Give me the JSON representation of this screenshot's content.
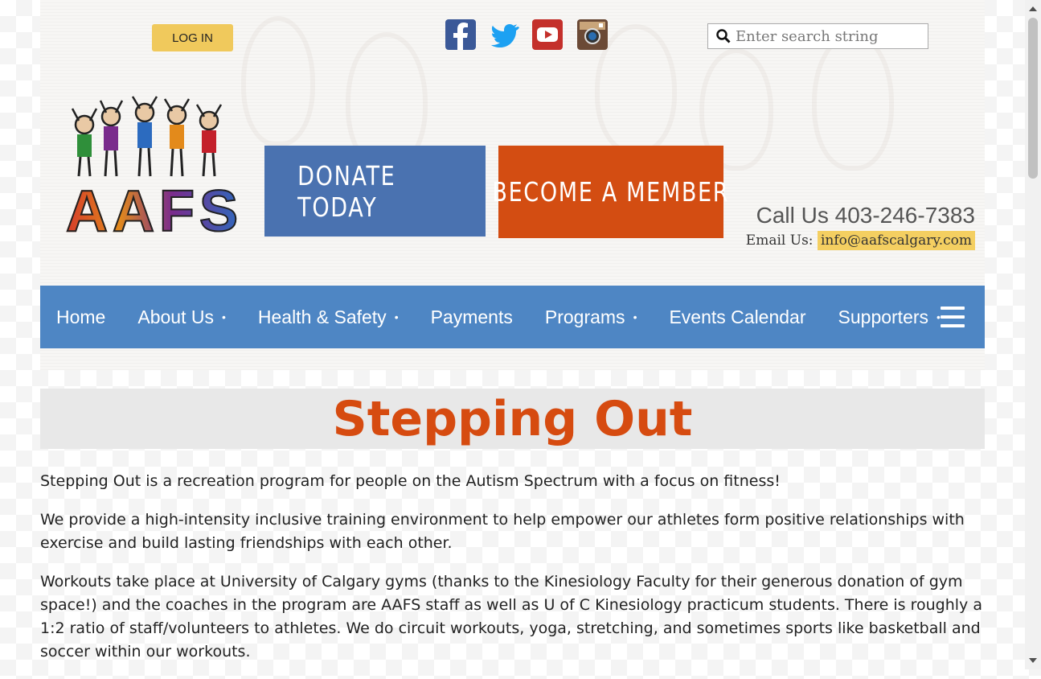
{
  "header": {
    "login_label": "LOG IN",
    "search_placeholder": "Enter search string",
    "social": [
      {
        "name": "facebook",
        "icon": "facebook-icon"
      },
      {
        "name": "twitter",
        "icon": "twitter-icon"
      },
      {
        "name": "youtube",
        "icon": "youtube-icon"
      },
      {
        "name": "instagram",
        "icon": "instagram-icon"
      }
    ],
    "logo_text": "AAFS",
    "donate_label": "DONATE TODAY",
    "member_label": "BECOME A MEMBER",
    "call_us": "Call Us 403-246-7383",
    "email_label": "Email Us:",
    "email": "info@aafscalgary.com"
  },
  "nav": {
    "items": [
      {
        "label": "Home",
        "has_sub": false
      },
      {
        "label": "About Us",
        "has_sub": true
      },
      {
        "label": "Health & Safety",
        "has_sub": true
      },
      {
        "label": "Payments",
        "has_sub": false
      },
      {
        "label": "Programs",
        "has_sub": true
      },
      {
        "label": "Events Calendar",
        "has_sub": false
      },
      {
        "label": "Supporters",
        "has_sub": true
      }
    ],
    "dot": "•"
  },
  "main": {
    "title": "Stepping Out",
    "paragraphs": [
      "Stepping Out is a recreation program for people on the Autism Spectrum with a focus on fitness!",
      "We provide a high-intensity inclusive training environment to help empower our athletes form positive relationships with exercise and build lasting friendships with each other.",
      "Workouts take place at University of Calgary gyms (thanks to the Kinesiology Faculty for their generous donation of gym space!) and the coaches in the program are AAFS staff as well as U of C Kinesiology practicum students. There is roughly a 1:2 ratio of staff/volunteers to athletes. We do circuit workouts, yoga, stretching, and sometimes sports like basketball and soccer within our workouts."
    ]
  },
  "colors": {
    "nav_blue": "#4e86c4",
    "donate_blue": "#4a72b0",
    "accent_orange": "#d34d12",
    "title_orange": "#d64b10",
    "login_yellow": "#f0c95c"
  }
}
